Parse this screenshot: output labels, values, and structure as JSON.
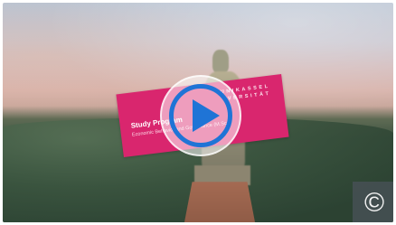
{
  "card": {
    "university_line1": "UNIKASSEL",
    "university_line2": "VERSITÄT",
    "program_title": "Study Program",
    "program_subtitle": "Economic Behavior and Governance (M.Sc.)"
  },
  "controls": {
    "copyright_symbol": "©"
  },
  "colors": {
    "card_pink": "#d9266e",
    "play_blue": "#1f74d6"
  }
}
